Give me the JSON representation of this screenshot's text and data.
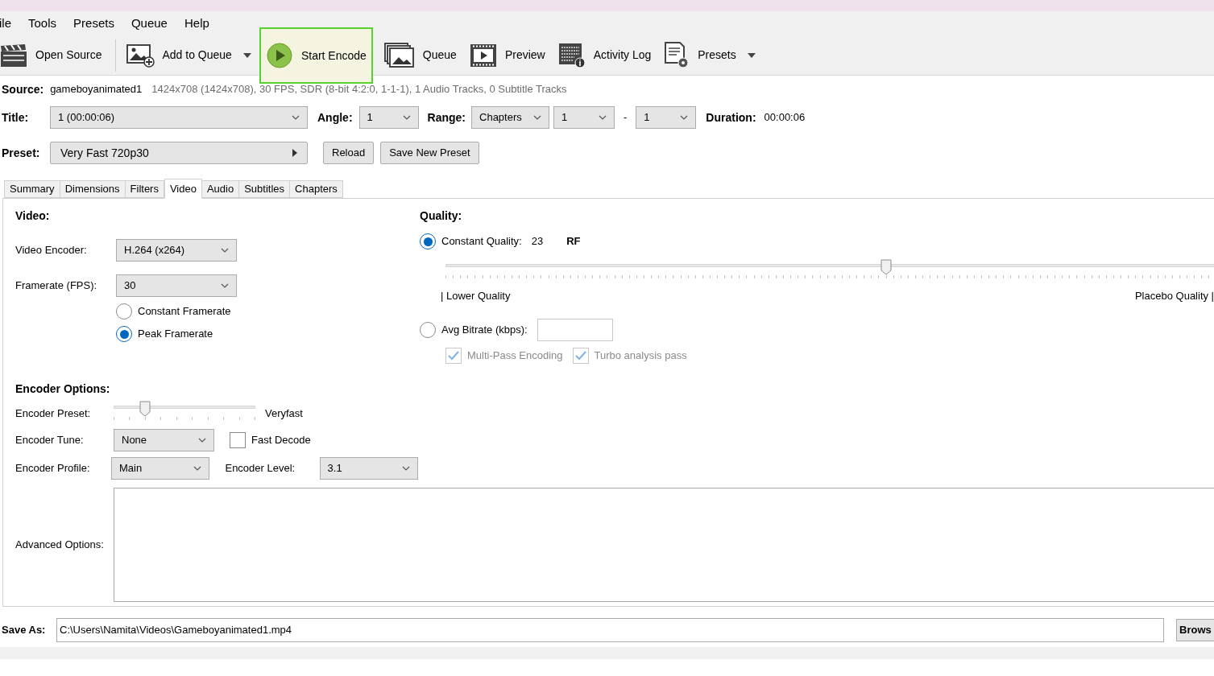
{
  "menu": [
    "ile",
    "Tools",
    "Presets",
    "Queue",
    "Help"
  ],
  "toolbar": [
    {
      "kind": "clapper",
      "label": "Open Source",
      "dropdown": false,
      "highlighted": false
    },
    {
      "kind": "add",
      "label": "Add to Queue",
      "dropdown": true,
      "highlighted": false
    },
    {
      "kind": "play",
      "label": "Start Encode",
      "dropdown": false,
      "highlighted": true
    },
    {
      "kind": "stack",
      "label": "Queue",
      "dropdown": false,
      "highlighted": false
    },
    {
      "kind": "film",
      "label": "Preview",
      "dropdown": false,
      "highlighted": false
    },
    {
      "kind": "log",
      "label": "Activity Log",
      "dropdown": false,
      "highlighted": false
    },
    {
      "kind": "gear",
      "label": "Presets",
      "dropdown": true,
      "highlighted": false
    }
  ],
  "source": {
    "label": "Source:",
    "name": "gameboyanimated1",
    "info": "1424x708 (1424x708), 30 FPS, SDR (8-bit 4:2:0, 1-1-1), 1 Audio Tracks, 0 Subtitle Tracks"
  },
  "title_row": {
    "title": {
      "label": "Title:",
      "value": "1  (00:00:06)"
    },
    "angle": {
      "label": "Angle:",
      "value": "1"
    },
    "range": {
      "label": "Range:",
      "mode": "Chapters",
      "start": "1",
      "separator": "-",
      "end": "1"
    },
    "duration": {
      "label": "Duration:",
      "value": "00:00:06"
    }
  },
  "preset": {
    "label": "Preset:",
    "value": "Very Fast 720p30",
    "buttons": [
      "Reload",
      "Save New Preset"
    ]
  },
  "tabs": [
    {
      "label": "Summary",
      "selected": false
    },
    {
      "label": "Dimensions",
      "selected": false
    },
    {
      "label": "Filters",
      "selected": false
    },
    {
      "label": "Video",
      "selected": true
    },
    {
      "label": "Audio",
      "selected": false
    },
    {
      "label": "Subtitles",
      "selected": false
    },
    {
      "label": "Chapters",
      "selected": false
    }
  ],
  "video": {
    "heading": "Video:",
    "encoder": {
      "label": "Video Encoder:",
      "value": "H.264 (x264)"
    },
    "framerate": {
      "label": "Framerate (FPS):",
      "value": "30"
    },
    "framerate_modes": [
      {
        "label": "Constant Framerate",
        "selected": false
      },
      {
        "label": "Peak Framerate",
        "selected": true
      }
    ]
  },
  "quality": {
    "heading": "Quality:",
    "constant": {
      "label": "Constant Quality:",
      "value": "23",
      "unit": "RF",
      "selected": true
    },
    "slider": {
      "level": 0.55,
      "low_label": "| Lower Quality",
      "high_label": "Placebo Quality |"
    },
    "bitrate": {
      "label": "Avg Bitrate (kbps):",
      "selected": false
    },
    "options": [
      {
        "label": "Multi-Pass Encoding",
        "checked": true,
        "disabled": true
      },
      {
        "label": "Turbo analysis pass",
        "checked": true,
        "disabled": true
      }
    ]
  },
  "encoder_options": {
    "heading": "Encoder Options:",
    "preset": {
      "label": "Encoder Preset:",
      "level": 0.22,
      "value": "Veryfast"
    },
    "tune": {
      "label": "Encoder Tune:",
      "value": "None"
    },
    "fast_decode": {
      "label": "Fast Decode",
      "checked": false
    },
    "profile": {
      "label": "Encoder Profile:",
      "value": "Main"
    },
    "level": {
      "label": "Encoder Level:",
      "value": "3.1"
    },
    "advanced": {
      "label": "Advanced Options:"
    }
  },
  "save_as": {
    "label": "Save As:",
    "value": "C:\\Users\\Namita\\Videos\\Gameboyanimated1.mp4",
    "button": "Brows"
  }
}
